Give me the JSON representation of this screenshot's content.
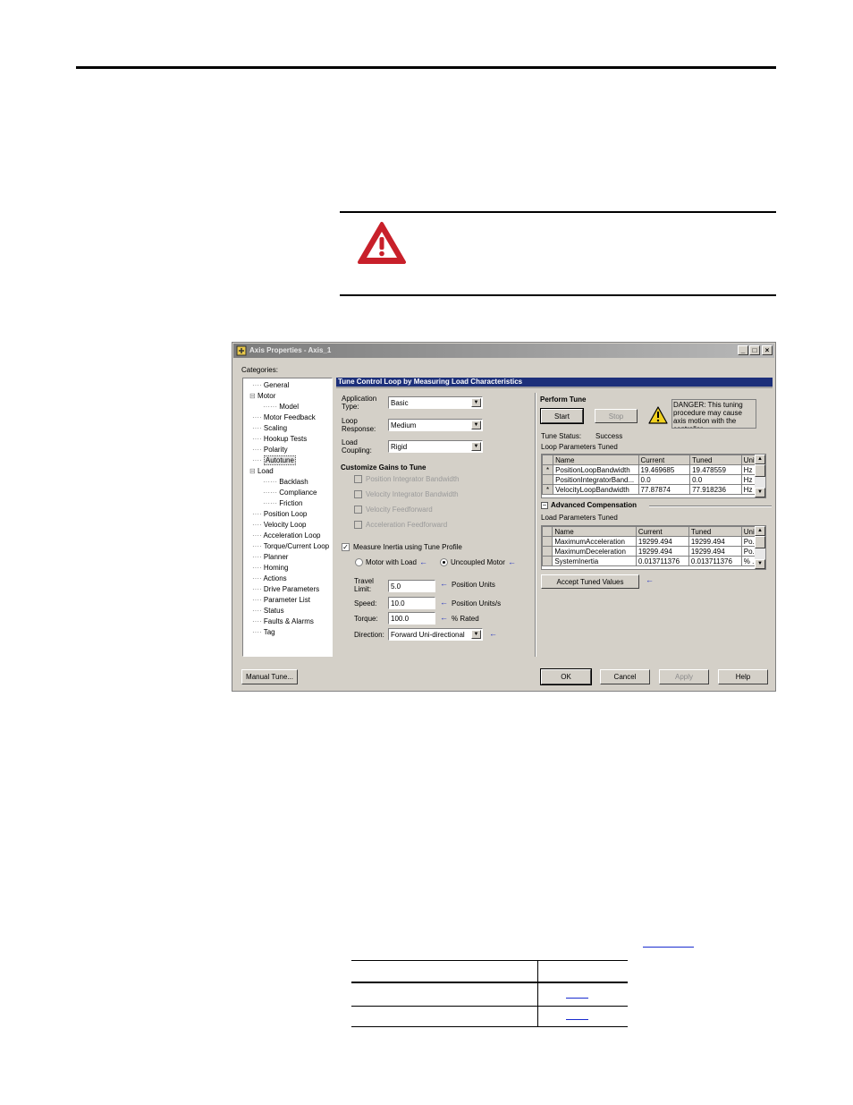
{
  "window": {
    "title": "Axis Properties - Axis_1",
    "min": "_",
    "max": "□",
    "close": "×"
  },
  "categories": {
    "label": "Categories:",
    "items": [
      {
        "label": "General",
        "prefix": "···· "
      },
      {
        "label": "Motor",
        "prefix": "⊟ "
      },
      {
        "label": "Model",
        "prefix": "······ "
      },
      {
        "label": "Motor Feedback",
        "prefix": "···· "
      },
      {
        "label": "Scaling",
        "prefix": "···· "
      },
      {
        "label": "Hookup Tests",
        "prefix": "···· "
      },
      {
        "label": "Polarity",
        "prefix": "···· "
      },
      {
        "label": "Autotune",
        "prefix": "···· "
      },
      {
        "label": "Load",
        "prefix": "⊟ "
      },
      {
        "label": "Backlash",
        "prefix": "······ "
      },
      {
        "label": "Compliance",
        "prefix": "······ "
      },
      {
        "label": "Friction",
        "prefix": "······ "
      },
      {
        "label": "Position Loop",
        "prefix": "···· "
      },
      {
        "label": "Velocity Loop",
        "prefix": "···· "
      },
      {
        "label": "Acceleration Loop",
        "prefix": "···· "
      },
      {
        "label": "Torque/Current Loop",
        "prefix": "···· "
      },
      {
        "label": "Planner",
        "prefix": "···· "
      },
      {
        "label": "Homing",
        "prefix": "···· "
      },
      {
        "label": "Actions",
        "prefix": "···· "
      },
      {
        "label": "Drive Parameters",
        "prefix": "···· "
      },
      {
        "label": "Parameter List",
        "prefix": "···· "
      },
      {
        "label": "Status",
        "prefix": "···· "
      },
      {
        "label": "Faults & Alarms",
        "prefix": "···· "
      },
      {
        "label": "Tag",
        "prefix": "···· "
      }
    ]
  },
  "panel": {
    "header": "Tune Control Loop by Measuring Load Characteristics",
    "application_type_label1": "Application",
    "application_type_label2": "Type:",
    "application_type": "Basic",
    "loop_response_label1": "Loop",
    "loop_response_label2": "Response:",
    "loop_response": "Medium",
    "load_coupling_label1": "Load",
    "load_coupling_label2": "Coupling:",
    "load_coupling": "Rigid",
    "customize_heading": "Customize Gains to Tune",
    "gains": [
      "Position Integrator Bandwidth",
      "Velocity Integrator Bandwidth",
      "Velocity Feedforward",
      "Acceleration Feedforward"
    ],
    "measure_inertia": "Measure Inertia using Tune Profile",
    "motor_with_load": "Motor with Load",
    "uncoupled_motor": "Uncoupled Motor",
    "travel_limit_label1": "Travel",
    "travel_limit_label2": "Limit:",
    "travel_limit": "5.0",
    "travel_units": "Position Units",
    "speed_label": "Speed:",
    "speed": "10.0",
    "speed_units": "Position Units/s",
    "torque_label": "Torque:",
    "torque": "100.0",
    "torque_units": "% Rated",
    "direction_label": "Direction:",
    "direction": "Forward Uni-directional"
  },
  "perform": {
    "heading": "Perform Tune",
    "start": "Start",
    "stop": "Stop",
    "danger": "DANGER: This tuning procedure may cause axis motion with the controller.",
    "status_label": "Tune Status:",
    "status": "Success",
    "loop_tuned_label": "Loop Parameters Tuned",
    "columns": [
      "Name",
      "Current",
      "Tuned",
      "Units"
    ],
    "loop_rows": [
      {
        "mark": "*",
        "name": "PositionLoopBandwidth",
        "current": "19.469685",
        "tuned": "19.478559",
        "units": "Hz"
      },
      {
        "mark": "",
        "name": "PositionIntegratorBand...",
        "current": "0.0",
        "tuned": "0.0",
        "units": "Hz"
      },
      {
        "mark": "*",
        "name": "VelocityLoopBandwidth",
        "current": "77.87874",
        "tuned": "77.918236",
        "units": "Hz"
      }
    ],
    "adv_heading": "Advanced Compensation",
    "load_tuned_label": "Load Parameters Tuned",
    "load_rows": [
      {
        "mark": "",
        "name": "MaximumAcceleration",
        "current": "19299.494",
        "tuned": "19299.494",
        "units": "Po..."
      },
      {
        "mark": "",
        "name": "MaximumDeceleration",
        "current": "19299.494",
        "tuned": "19299.494",
        "units": "Po..."
      },
      {
        "mark": "",
        "name": "SystemInertia",
        "current": "0.013711376",
        "tuned": "0.013711376",
        "units": "% ..."
      }
    ],
    "accept": "Accept Tuned Values"
  },
  "footer": {
    "manual_tune": "Manual Tune...",
    "ok": "OK",
    "cancel": "Cancel",
    "apply": "Apply",
    "help": "Help"
  },
  "colors": {
    "danger_red": "#c8202a",
    "warning_yellow": "#f0d020",
    "header_blue": "#1c2f7a",
    "arrow_blue": "#2030c0"
  }
}
